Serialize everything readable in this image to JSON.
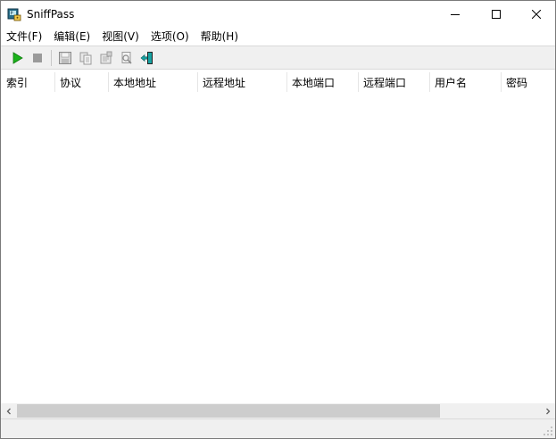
{
  "window": {
    "title": "SniffPass",
    "app_icon": "sniffpass-app-icon",
    "controls": {
      "minimize": "minimize-icon",
      "maximize": "maximize-icon",
      "close": "close-icon"
    }
  },
  "menu": [
    {
      "id": "file",
      "label": "文件(F)"
    },
    {
      "id": "edit",
      "label": "编辑(E)"
    },
    {
      "id": "view",
      "label": "视图(V)"
    },
    {
      "id": "options",
      "label": "选项(O)"
    },
    {
      "id": "help",
      "label": "帮助(H)"
    }
  ],
  "toolbar": {
    "buttons": [
      {
        "id": "start-capture",
        "icon": "play-icon",
        "enabled": true
      },
      {
        "id": "stop-capture",
        "icon": "stop-icon",
        "enabled": false
      },
      {
        "id": "save",
        "icon": "save-disk-icon",
        "enabled": false
      },
      {
        "id": "copy",
        "icon": "copy-icon",
        "enabled": false
      },
      {
        "id": "properties",
        "icon": "properties-icon",
        "enabled": false
      },
      {
        "id": "find",
        "icon": "find-icon",
        "enabled": false
      },
      {
        "id": "exit",
        "icon": "exit-door-icon",
        "enabled": true
      }
    ]
  },
  "list": {
    "columns": [
      {
        "id": "index",
        "label": "索引"
      },
      {
        "id": "protocol",
        "label": "协议"
      },
      {
        "id": "local-address",
        "label": "本地地址"
      },
      {
        "id": "remote-address",
        "label": "远程地址"
      },
      {
        "id": "local-port",
        "label": "本地端口"
      },
      {
        "id": "remote-port",
        "label": "远程端口"
      },
      {
        "id": "username",
        "label": "用户名"
      },
      {
        "id": "password",
        "label": "密码"
      }
    ],
    "rows": []
  },
  "scrollbar": {
    "horizontal": {
      "thumb_fraction": 0.81,
      "position_fraction": 0.0
    }
  },
  "colors": {
    "play_green": "#1bb31b",
    "stop_gray": "#9a9a9a",
    "exit_teal": "#17a3a3",
    "toolbar_bg": "#f0f0f0"
  }
}
